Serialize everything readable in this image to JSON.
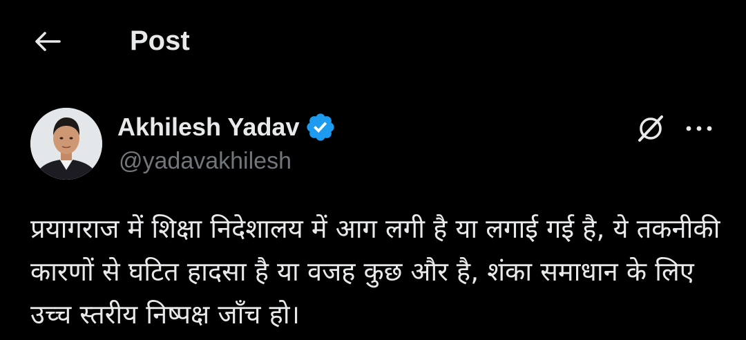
{
  "header": {
    "back_icon": "arrow-left-icon",
    "title": "Post"
  },
  "post": {
    "author": {
      "name": "Akhilesh Yadav",
      "handle": "@yadavakhilesh",
      "verified": true,
      "verified_icon": "verified-badge-icon",
      "avatar_icon": "avatar-photo"
    },
    "actions": {
      "grok_icon": "grok-icon",
      "more_icon": "more-horizontal-icon"
    },
    "text": "प्रयागराज में शिक्षा निदेशालय में आग लगी है या लगाई गई है, ये तकनीकी कारणों से घटित हादसा है या वजह कुछ और है, शंका समाधान के लिए उच्च स्तरीय निष्पक्ष जाँच हो।"
  },
  "colors": {
    "background": "#000000",
    "primary_text": "#e7e9ea",
    "secondary_text": "#71767b",
    "verified_blue": "#1d9bf0"
  }
}
